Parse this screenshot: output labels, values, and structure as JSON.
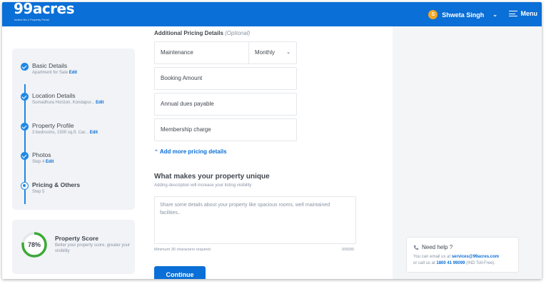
{
  "header": {
    "logo": "99acres",
    "tagline": "India's No.1 Property Portal",
    "user_initial": "S",
    "user_name": "Shweta Singh",
    "menu_label": "Menu",
    "accent": "#0a6fd6"
  },
  "steps": [
    {
      "title": "Basic Details",
      "sub": "Apartment for Sale",
      "edit": "Edit",
      "status": "done"
    },
    {
      "title": "Location Details",
      "sub": "Sumadhura Horizon, Kondapur...",
      "edit": "Edit",
      "status": "done"
    },
    {
      "title": "Property Profile",
      "sub": "3 bedrooms, 1500 sq.ft. Car...",
      "edit": "Edit",
      "status": "done"
    },
    {
      "title": "Photos",
      "sub": "Step 4",
      "edit": "Edit",
      "status": "done"
    },
    {
      "title": "Pricing & Others",
      "sub": "Step 5",
      "edit": "",
      "status": "current"
    }
  ],
  "score": {
    "value": "78%",
    "fraction": 0.78,
    "title": "Property Score",
    "desc": "Better your property score, greater your visibility",
    "color": "#3aaa35"
  },
  "pricing": {
    "label": "Additional Pricing Details",
    "optional": "(Optional)",
    "fields": [
      {
        "placeholder": "Maintenance",
        "period": "Monthly"
      },
      {
        "placeholder": "Booking Amount"
      },
      {
        "placeholder": "Annual dues payable"
      },
      {
        "placeholder": "Membership charge"
      }
    ],
    "more_link": "Add more pricing details"
  },
  "unique": {
    "title": "What makes your property unique",
    "sub": "Adding description will increase your listing visibility",
    "placeholder": "Share some details about your property like spacious rooms, well maintained facilities..",
    "min_req": "Minimum 30 characters required",
    "counter": "0/5000",
    "continue": "Continue"
  },
  "help": {
    "title": "Need help ?",
    "line1_prefix": "You can email us at",
    "email": "services@99acres.com",
    "line2_prefix": "or call us at",
    "phone": "1800 41 99099",
    "line2_suffix": "(IND Toll-Free)."
  }
}
